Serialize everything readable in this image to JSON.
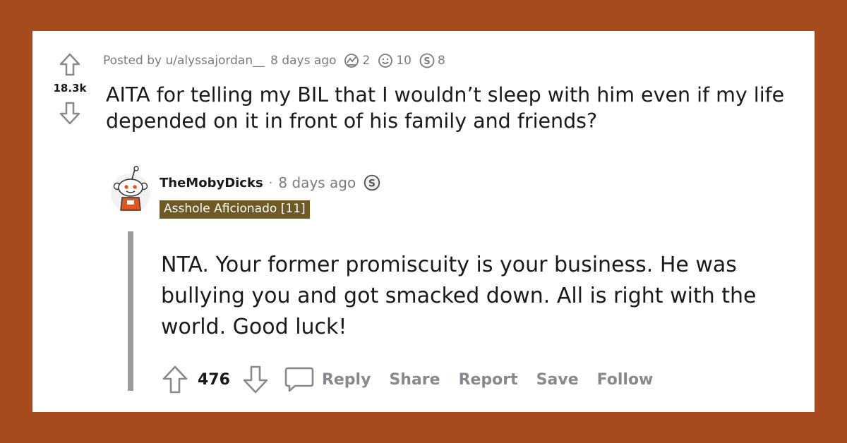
{
  "post": {
    "posted_by": "Posted by u/alyssajordan__",
    "time": "8 days ago",
    "score": "18.3k",
    "title": "AITA for telling my BIL that I wouldn’t sleep with him even if my life depended on it in front of his family and friends?",
    "awards": [
      {
        "icon": "helpful-award-icon",
        "count": "2"
      },
      {
        "icon": "wholesome-award-icon",
        "count": "10"
      },
      {
        "icon": "silver-award-icon",
        "count": "8"
      }
    ]
  },
  "comment": {
    "author": "TheMobyDicks",
    "separator": "·",
    "time": "8 days ago",
    "flair": "Asshole Aficionado [11]",
    "body": "NTA. Your former promiscuity is your business. He was bullying you and got smacked down. All is right with the world. Good luck!",
    "score": "476",
    "actions": {
      "reply": "Reply",
      "share": "Share",
      "report": "Report",
      "save": "Save",
      "follow": "Follow"
    }
  },
  "colors": {
    "background": "#a64b1e",
    "flair_bg": "#6e5a24",
    "action_text": "#878a8c",
    "thread_line": "#9b9b9b"
  }
}
